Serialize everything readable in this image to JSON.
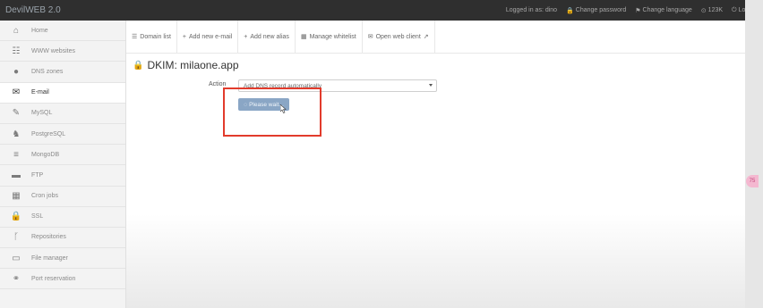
{
  "app": {
    "brand": "DevilWEB 2.0"
  },
  "topnav": [
    {
      "label": "Logged in as: dino",
      "icon": ""
    },
    {
      "label": "Change password",
      "icon": "lock-icon"
    },
    {
      "label": "Change language",
      "icon": "flag-icon"
    },
    {
      "label": "123K",
      "icon": "info-icon"
    },
    {
      "label": "Logout",
      "icon": "power-icon"
    }
  ],
  "sidebar": {
    "items": [
      {
        "label": "Home",
        "icon": "home-icon",
        "active": false
      },
      {
        "label": "WWW websites",
        "icon": "grid-icon",
        "active": false
      },
      {
        "label": "DNS zones",
        "icon": "globe-icon",
        "active": false
      },
      {
        "label": "E-mail",
        "icon": "envelope-icon",
        "active": true
      },
      {
        "label": "MySQL",
        "icon": "feather-icon",
        "active": false
      },
      {
        "label": "PostgreSQL",
        "icon": "elephant-icon",
        "active": false
      },
      {
        "label": "MongoDB",
        "icon": "database-icon",
        "active": false
      },
      {
        "label": "FTP",
        "icon": "folder-icon",
        "active": false
      },
      {
        "label": "Cron jobs",
        "icon": "calendar-icon",
        "active": false
      },
      {
        "label": "SSL",
        "icon": "lock-icon",
        "active": false
      },
      {
        "label": "Repositories",
        "icon": "branch-icon",
        "active": false
      },
      {
        "label": "File manager",
        "icon": "folder-open-icon",
        "active": false
      },
      {
        "label": "Port reservation",
        "icon": "link-icon",
        "active": false
      }
    ]
  },
  "subnav": [
    {
      "label": "Domain list",
      "icon": "list-icon"
    },
    {
      "label": "Add new e-mail",
      "icon": "plus-icon"
    },
    {
      "label": "Add new alias",
      "icon": "plus-icon"
    },
    {
      "label": "Manage whitelist",
      "icon": "calendar-icon"
    },
    {
      "label": "Open web client",
      "icon": "envelope-icon"
    }
  ],
  "page": {
    "title": "DKIM: milaone.app"
  },
  "form": {
    "action_label": "Action",
    "action_value": "Add DNS record automatically",
    "submit_label": "Please wait..."
  },
  "badge": "75"
}
